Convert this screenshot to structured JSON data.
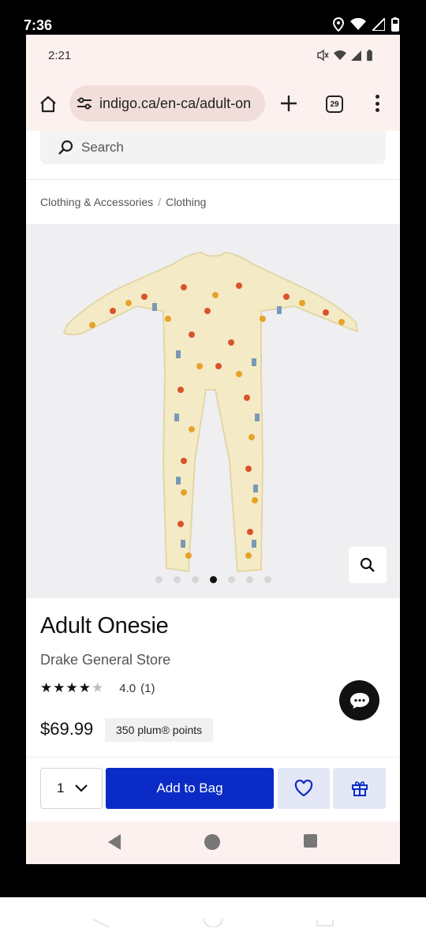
{
  "device": {
    "time": "7:36"
  },
  "inner_status": {
    "time": "2:21"
  },
  "browser": {
    "url": "indigo.ca/en-ca/adult-on",
    "tab_count": "29"
  },
  "search": {
    "placeholder": "Search"
  },
  "breadcrumb": {
    "items": [
      "Clothing & Accessories",
      "Clothing"
    ],
    "separator": "/"
  },
  "gallery": {
    "image": "onesie-image",
    "slide_count": 7,
    "active_slide": 4
  },
  "product": {
    "title": "Adult Onesie",
    "brand": "Drake General Store",
    "rating_stars": 4,
    "rating_max": 5,
    "score": "4.0",
    "review_count": "(1)",
    "price": "$69.99",
    "points": "350 plum® points"
  },
  "actions": {
    "quantity": "1",
    "add_to_bag": "Add to Bag"
  },
  "colors": {
    "primary": "#0a2bc5",
    "secondary_button": "#e3e7f6",
    "browser_chrome": "#fdf1f0"
  }
}
